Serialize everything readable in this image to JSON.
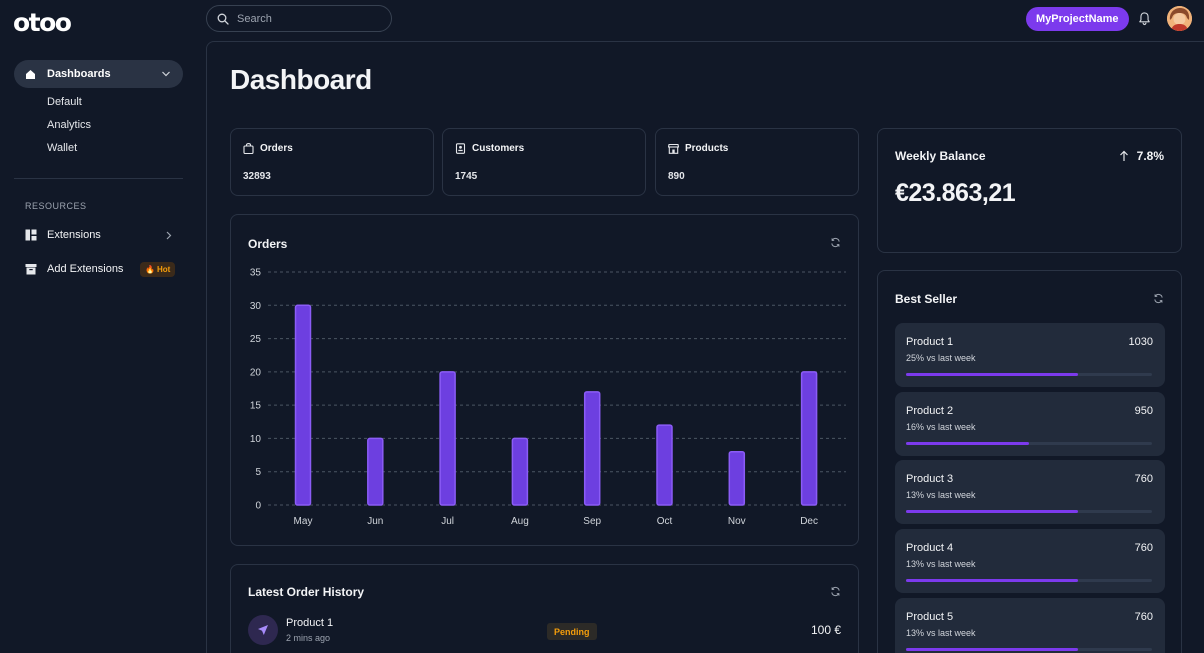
{
  "header": {
    "logo": "otoo",
    "search_placeholder": "Search",
    "project_button": "MyProjectName"
  },
  "sidebar": {
    "active": "Dashboards",
    "sub_items": [
      "Default",
      "Analytics",
      "Wallet"
    ],
    "section": "RESOURCES",
    "extensions": "Extensions",
    "add_extensions": "Add Extensions",
    "hot_badge": "Hot"
  },
  "main": {
    "title": "Dashboard",
    "stats": [
      {
        "label": "Orders",
        "value": "32893"
      },
      {
        "label": "Customers",
        "value": "1745"
      },
      {
        "label": "Products",
        "value": "890"
      }
    ],
    "weekly_balance": {
      "title": "Weekly Balance",
      "change": "7.8%",
      "amount": "€23.863,21"
    },
    "orders_chart_title": "Orders",
    "best_seller": {
      "title": "Best Seller",
      "items": [
        {
          "name": "Product 1",
          "sub": "25% vs last week",
          "value": "1030",
          "progress": 0.7
        },
        {
          "name": "Product 2",
          "sub": "16% vs last week",
          "value": "950",
          "progress": 0.5
        },
        {
          "name": "Product 3",
          "sub": "13% vs last week",
          "value": "760",
          "progress": 0.7
        },
        {
          "name": "Product 4",
          "sub": "13% vs last week",
          "value": "760",
          "progress": 0.7
        },
        {
          "name": "Product 5",
          "sub": "13% vs last week",
          "value": "760",
          "progress": 0.7
        }
      ]
    },
    "order_history": {
      "title": "Latest Order History",
      "rows": [
        {
          "name": "Product 1",
          "time": "2 mins ago",
          "status": "Pending",
          "amount": "100 €"
        }
      ]
    }
  },
  "colors": {
    "accent": "#7c3aed",
    "bar": "#6d3fe0",
    "background": "#111827",
    "warning": "#f59e0b"
  },
  "chart_data": {
    "type": "bar",
    "title": "Orders",
    "categories": [
      "May",
      "Jun",
      "Jul",
      "Aug",
      "Sep",
      "Oct",
      "Nov",
      "Dec"
    ],
    "values": [
      30,
      10,
      20,
      10,
      17,
      12,
      8,
      20
    ],
    "ylim": [
      0,
      35
    ],
    "yticks": [
      0,
      5,
      10,
      15,
      20,
      25,
      30,
      35
    ],
    "grid": true,
    "xlabel": "",
    "ylabel": ""
  }
}
